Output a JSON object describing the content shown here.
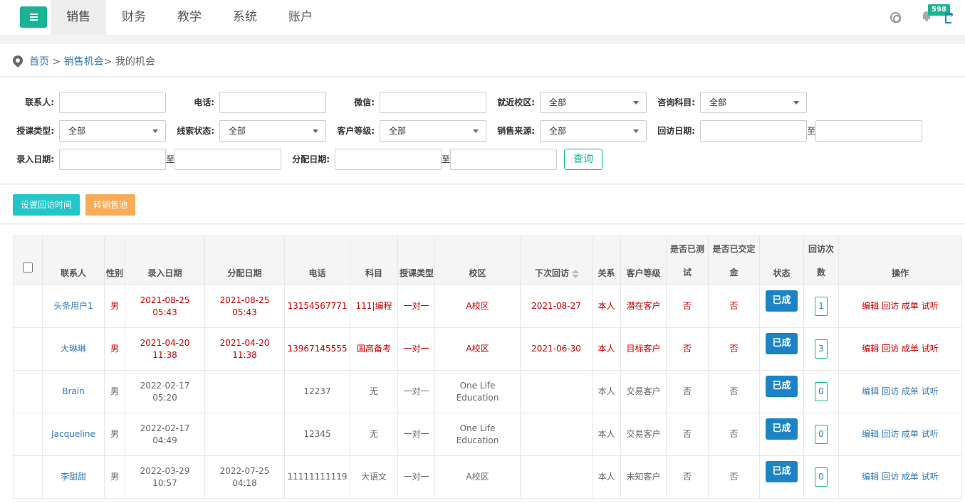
{
  "nav": {
    "items": [
      "销售",
      "财务",
      "教学",
      "系统",
      "账户"
    ],
    "active": "销售",
    "notification_count": "598"
  },
  "breadcrumb": {
    "home": "首页",
    "separator1": " > ",
    "section": "销售机会",
    "separator2": "> ",
    "current": "我的机会"
  },
  "filters": {
    "contact_label": "联系人:",
    "phone_label": "电话:",
    "wechat_label": "微信:",
    "campus_label": "就近校区:",
    "campus_value": "全部",
    "subject_label": "咨询科目:",
    "subject_value": "全部",
    "course_type_label": "授课类型:",
    "course_type_value": "全部",
    "lead_status_label": "线索状态:",
    "lead_status_value": "全部",
    "level_label": "客户等级:",
    "level_value": "全部",
    "source_label": "销售来源:",
    "source_value": "全部",
    "visit_date_label": "回访日期:",
    "entry_date_label": "录入日期:",
    "assign_date_label": "分配日期:",
    "to": "至",
    "query_button": "查询"
  },
  "actions": {
    "set_visit_time": "设置回访时间",
    "to_sales_pool": "转销售池"
  },
  "table": {
    "headers": {
      "contact": "联系人",
      "gender": "性别",
      "entry_date": "录入日期",
      "assign_date": "分配日期",
      "phone": "电话",
      "subject": "科目",
      "course_type": "授课类型",
      "campus": "校区",
      "next_visit": "下次回访",
      "relation": "关系",
      "level": "客户等级",
      "tested_1": "是否已测",
      "tested_2": "试",
      "deposit_1": "是否已交定",
      "deposit_2": "金",
      "status": "状态",
      "visits_1": "回访次",
      "visits_2": "数",
      "ops": "操作"
    },
    "ops_labels": [
      "编辑",
      "回访",
      "成单",
      "试听"
    ],
    "rows": [
      {
        "highlight": true,
        "contact": "头条用户1",
        "gender": "男",
        "entry_date": "2021-08-25 05:43",
        "assign_date": "2021-08-25 05:43",
        "phone": "13154567771",
        "subject": "111|编程",
        "course_type": "一对一",
        "campus": "A校区",
        "next_visit": "2021-08-27",
        "relation": "本人",
        "level": "潜在客户",
        "tested": "否",
        "deposit": "否",
        "status": "已成",
        "visits": "1"
      },
      {
        "highlight": true,
        "contact": "大琳琳",
        "gender": "男",
        "entry_date": "2021-04-20 11:38",
        "assign_date": "2021-04-20 11:38",
        "phone": "13967145555",
        "subject": "国高备考",
        "course_type": "一对一",
        "campus": "A校区",
        "next_visit": "2021-06-30",
        "relation": "本人",
        "level": "目标客户",
        "tested": "否",
        "deposit": "否",
        "status": "已成",
        "visits": "3"
      },
      {
        "highlight": false,
        "contact": "Brain",
        "gender": "男",
        "entry_date": "2022-02-17 05:20",
        "assign_date": "",
        "phone": "12237",
        "subject": "无",
        "course_type": "一对一",
        "campus": "One Life Education",
        "next_visit": "",
        "relation": "本人",
        "level": "交易客户",
        "tested": "否",
        "deposit": "否",
        "status": "已成",
        "visits": "0"
      },
      {
        "highlight": false,
        "contact": "Jacqueline",
        "gender": "男",
        "entry_date": "2022-02-17 04:49",
        "assign_date": "",
        "phone": "12345",
        "subject": "无",
        "course_type": "一对一",
        "campus": "One Life Education",
        "next_visit": "",
        "relation": "本人",
        "level": "交易客户",
        "tested": "否",
        "deposit": "否",
        "status": "已成",
        "visits": "0"
      },
      {
        "highlight": false,
        "contact": "李甜甜",
        "gender": "男",
        "entry_date": "2022-03-29 10:57",
        "assign_date": "2022-07-25 04:18",
        "phone": "11111111119",
        "subject": "大语文",
        "course_type": "一对一",
        "campus": "A校区",
        "next_visit": "",
        "relation": "本人",
        "level": "未知客户",
        "tested": "否",
        "deposit": "否",
        "status": "已成",
        "visits": "0"
      }
    ]
  }
}
